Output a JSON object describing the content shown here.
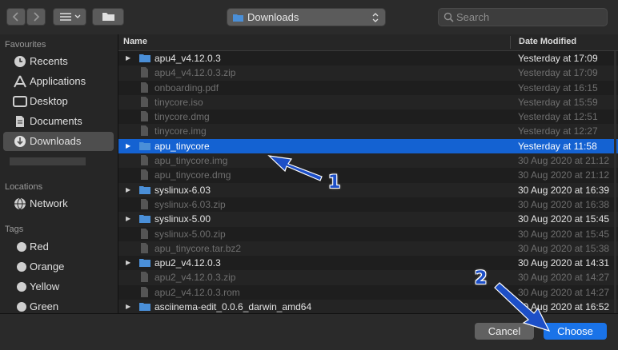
{
  "colors": {
    "accent": "#1a73e8",
    "selection": "#1462d2",
    "annotation": "#1d4fc7",
    "folder": "#4a8fd8"
  },
  "toolbar": {
    "back_icon": "chevron-left-icon",
    "forward_icon": "chevron-right-icon",
    "view_icon": "list-view-icon",
    "new_folder_icon": "new-folder-icon",
    "location": "Downloads",
    "search_placeholder": "Search"
  },
  "sidebar": {
    "favourites_header": "Favourites",
    "favourites": [
      {
        "label": "Recents",
        "icon": "clock-icon"
      },
      {
        "label": "Applications",
        "icon": "applications-icon"
      },
      {
        "label": "Desktop",
        "icon": "desktop-icon"
      },
      {
        "label": "Documents",
        "icon": "document-icon"
      },
      {
        "label": "Downloads",
        "icon": "download-icon",
        "selected": true
      }
    ],
    "locations_header": "Locations",
    "locations": [
      {
        "label": "Network",
        "icon": "globe-icon"
      }
    ],
    "tags_header": "Tags",
    "tags": [
      {
        "label": "Red"
      },
      {
        "label": "Orange"
      },
      {
        "label": "Yellow"
      },
      {
        "label": "Green"
      }
    ]
  },
  "columns": {
    "name": "Name",
    "date": "Date Modified"
  },
  "files": [
    {
      "name": "apu4_v4.12.0.3",
      "date": "Yesterday at 17:09",
      "type": "folder",
      "dim": false
    },
    {
      "name": "apu4_v4.12.0.3.zip",
      "date": "Yesterday at 17:09",
      "type": "file",
      "dim": true
    },
    {
      "name": "onboarding.pdf",
      "date": "Yesterday at 16:15",
      "type": "file",
      "dim": true
    },
    {
      "name": "tinycore.iso",
      "date": "Yesterday at 15:59",
      "type": "file",
      "dim": true
    },
    {
      "name": "tinycore.dmg",
      "date": "Yesterday at 12:51",
      "type": "file",
      "dim": true
    },
    {
      "name": "tinycore.img",
      "date": "Yesterday at 12:27",
      "type": "file",
      "dim": true
    },
    {
      "name": "apu_tinycore",
      "date": "Yesterday at 11:58",
      "type": "folder",
      "dim": false,
      "selected": true
    },
    {
      "name": "apu_tinycore.img",
      "date": "30 Aug 2020 at 21:12",
      "type": "file",
      "dim": true
    },
    {
      "name": "apu_tinycore.dmg",
      "date": "30 Aug 2020 at 21:12",
      "type": "file",
      "dim": true
    },
    {
      "name": "syslinux-6.03",
      "date": "30 Aug 2020 at 16:39",
      "type": "folder",
      "dim": false
    },
    {
      "name": "syslinux-6.03.zip",
      "date": "30 Aug 2020 at 16:38",
      "type": "file",
      "dim": true
    },
    {
      "name": "syslinux-5.00",
      "date": "30 Aug 2020 at 15:45",
      "type": "folder",
      "dim": false
    },
    {
      "name": "syslinux-5.00.zip",
      "date": "30 Aug 2020 at 15:45",
      "type": "file",
      "dim": true
    },
    {
      "name": "apu_tinycore.tar.bz2",
      "date": "30 Aug 2020 at 15:38",
      "type": "file",
      "dim": true
    },
    {
      "name": "apu2_v4.12.0.3",
      "date": "30 Aug 2020 at 14:31",
      "type": "folder",
      "dim": false
    },
    {
      "name": "apu2_v4.12.0.3.zip",
      "date": "30 Aug 2020 at 14:27",
      "type": "file",
      "dim": true
    },
    {
      "name": "apu2_v4.12.0.3.rom",
      "date": "30 Aug 2020 at 14:27",
      "type": "file",
      "dim": true
    },
    {
      "name": "asciinema-edit_0.0.6_darwin_amd64",
      "date": "30 Aug 2020 at 16:52",
      "type": "folder",
      "dim": false
    }
  ],
  "buttons": {
    "cancel": "Cancel",
    "choose": "Choose"
  },
  "annotations": {
    "step1": "1",
    "step2": "2"
  }
}
